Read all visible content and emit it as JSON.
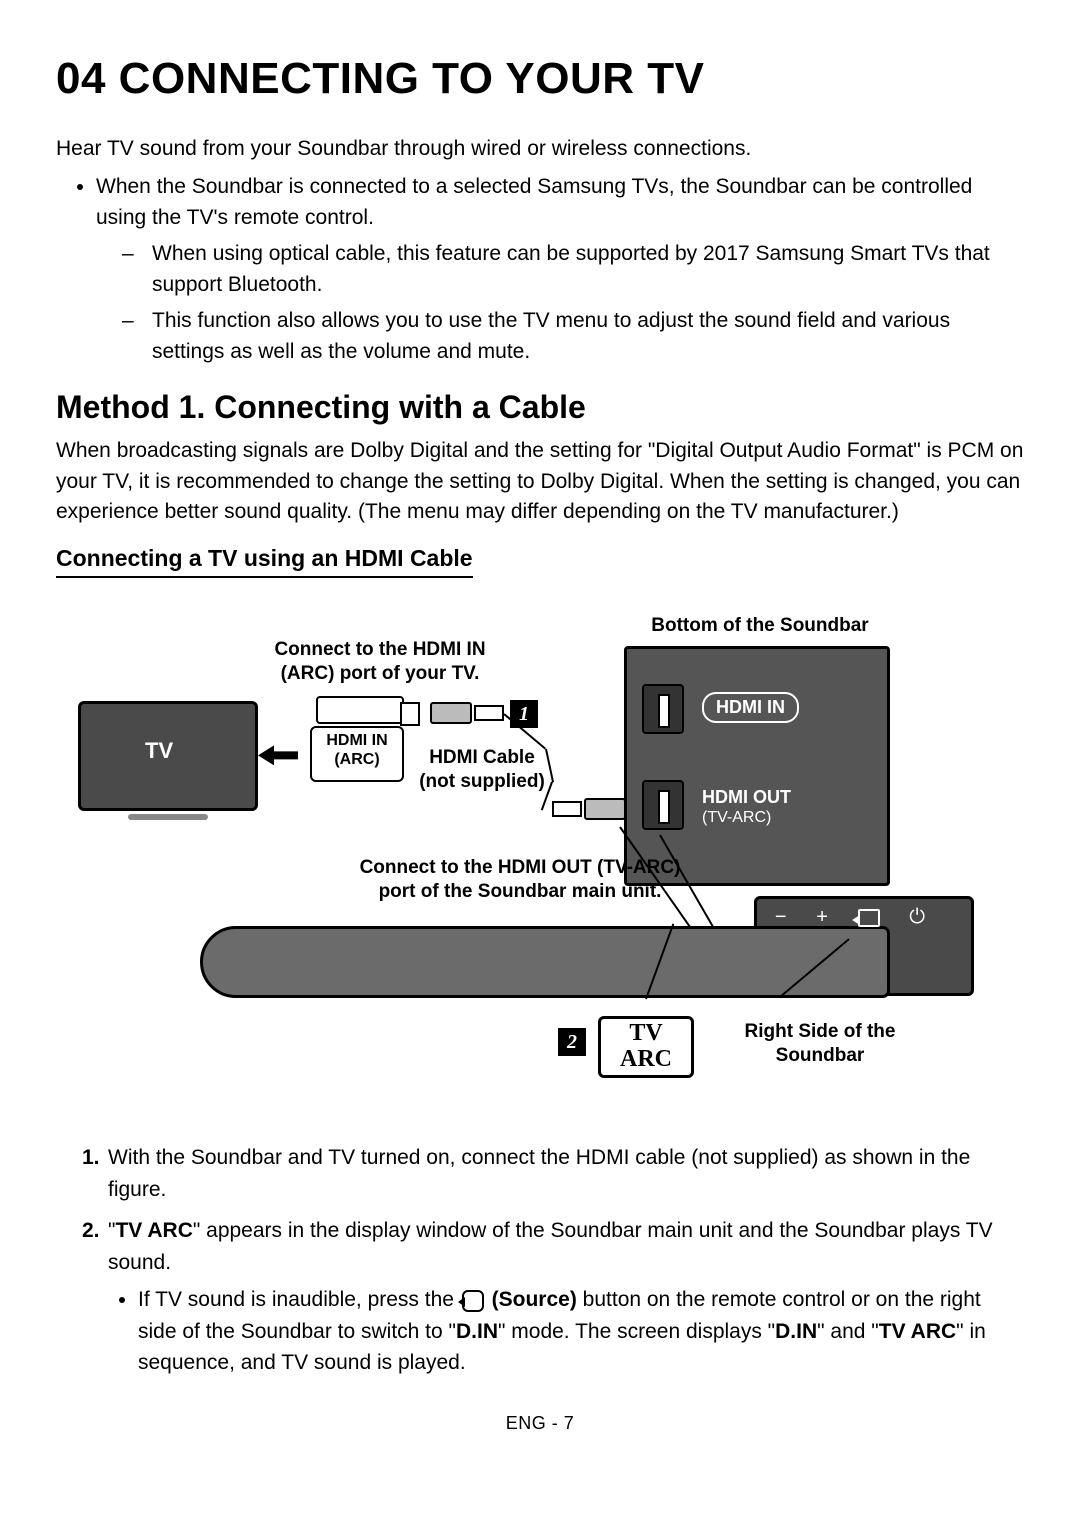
{
  "heading": "04   CONNECTING TO YOUR TV",
  "intro": "Hear TV sound from your Soundbar through wired or wireless connections.",
  "bullets": {
    "b0": "When the Soundbar is connected to a selected Samsung TVs, the Soundbar can be controlled using the TV's remote control.",
    "dashes": {
      "d0": "When using optical cable, this feature can be supported by 2017 Samsung Smart TVs that support Bluetooth.",
      "d1": "This function also allows you to use the TV menu to adjust the sound field and various settings as well as the volume and mute."
    }
  },
  "method_title": "Method 1. Connecting with a Cable",
  "method_para": "When broadcasting signals are Dolby Digital and the setting for \"Digital Output Audio Format\" is PCM on your TV, it is recommended to change the setting to Dolby Digital. When the setting is changed, you can experience better sound quality. (The menu may differ depending on the TV manufacturer.)",
  "sub_title": "Connecting a TV using an HDMI Cable",
  "figure": {
    "tv_instruction_l1": "Connect to the HDMI IN",
    "tv_instruction_l2": "(ARC) port of your TV.",
    "tv_label": "TV",
    "hdmi_in_arc_l1": "HDMI IN",
    "hdmi_in_arc_l2": "(ARC)",
    "hdmi_cable_l1": "HDMI Cable",
    "hdmi_cable_l2": "(not supplied)",
    "bottom_label": "Bottom of the Soundbar",
    "hdmi_in_pill": "HDMI IN",
    "hdmi_out_l1": "HDMI OUT",
    "hdmi_out_l2": "(TV-ARC)",
    "soundbar_instruction_l1": "Connect to the HDMI OUT (TV-ARC)",
    "soundbar_instruction_l2": "port of the Soundbar main unit.",
    "tv_arc_l1": "TV",
    "tv_arc_l2": "ARC",
    "right_side_l1": "Right Side of the",
    "right_side_l2": "Soundbar",
    "badge1": "1",
    "badge2": "2",
    "side_icons": {
      "minus": "−",
      "plus": "+",
      "power": "⏻"
    }
  },
  "steps": {
    "s1_num": "1.",
    "s1": "With the Soundbar and TV turned on, connect the HDMI cable (not supplied) as shown in the figure.",
    "s2_num": "2.",
    "s2_pre": "\"",
    "s2_bold1": "TV ARC",
    "s2_post1": "\" appears in the display window of the Soundbar main unit and the Soundbar plays TV sound.",
    "s2_sub_pre": "If TV sound is inaudible, press the ",
    "s2_sub_source": " (Source)",
    "s2_sub_mid1": " button on the remote control or on the right side of the Soundbar to switch to \"",
    "s2_sub_bold_din1": "D.IN",
    "s2_sub_mid2": "\" mode. The screen displays \"",
    "s2_sub_bold_din2": "D.IN",
    "s2_sub_mid3": "\" and \"",
    "s2_sub_bold_tvarc": "TV ARC",
    "s2_sub_end": "\" in sequence, and TV sound is played."
  },
  "footer": "ENG - 7"
}
